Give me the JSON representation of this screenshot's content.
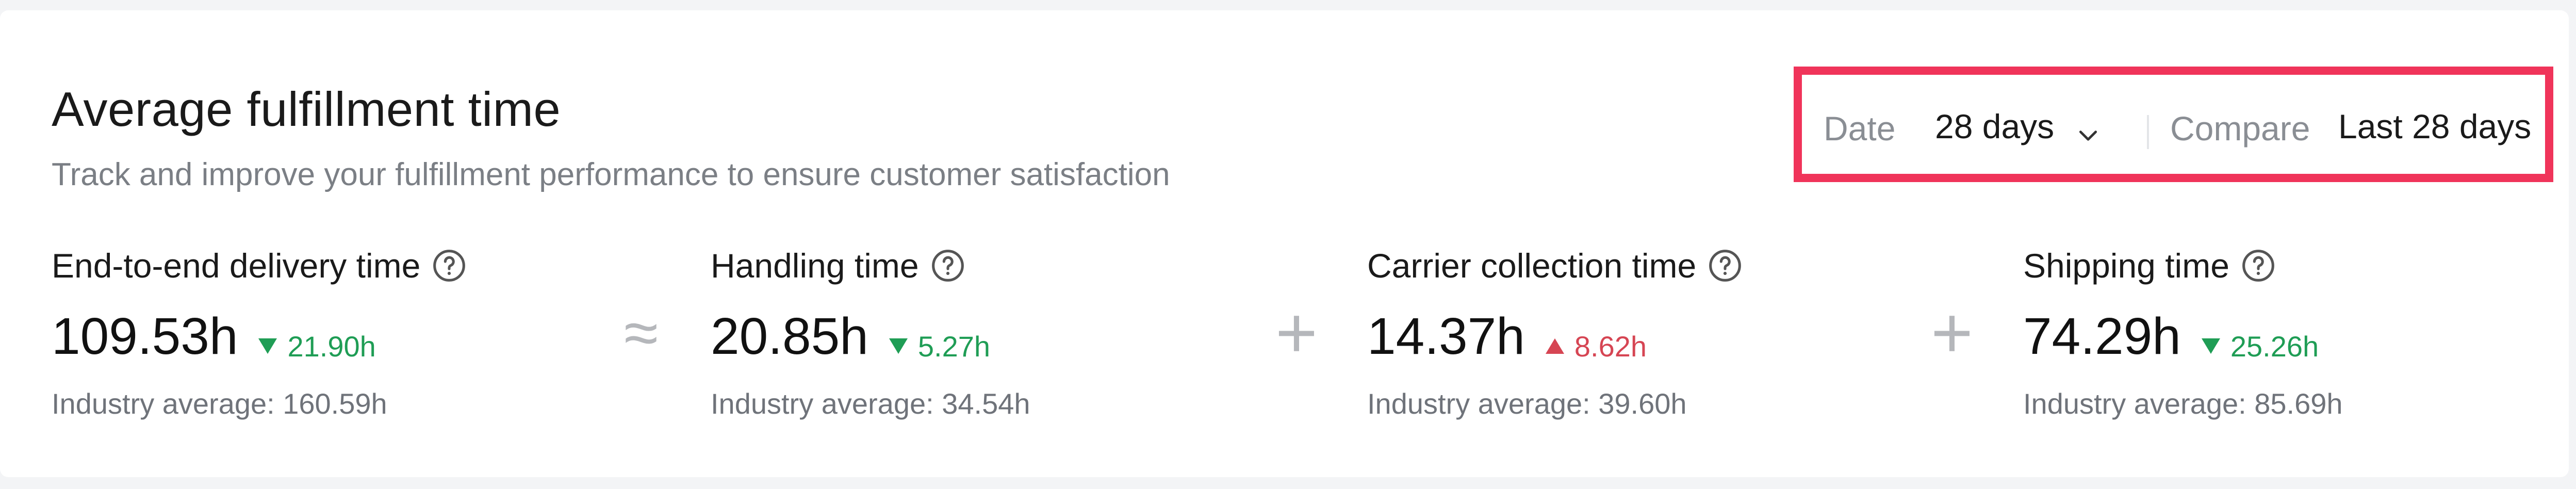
{
  "header": {
    "title": "Average fulfillment time",
    "subtitle": "Track and improve your fulfillment performance to ensure customer satisfaction"
  },
  "filters": {
    "date_label": "Date",
    "date_value": "28 days",
    "compare_label": "Compare",
    "compare_value": "Last 28 days",
    "highlight_color": "#f0345a"
  },
  "metrics": [
    {
      "title": "End-to-end delivery time",
      "value": "109.53h",
      "delta": "21.90h",
      "direction": "down",
      "industry": "Industry average: 160.59h"
    },
    {
      "title": "Handling time",
      "value": "20.85h",
      "delta": "5.27h",
      "direction": "down",
      "industry": "Industry average: 34.54h"
    },
    {
      "title": "Carrier collection time",
      "value": "14.37h",
      "delta": "8.62h",
      "direction": "up",
      "industry": "Industry average: 39.60h"
    },
    {
      "title": "Shipping time",
      "value": "74.29h",
      "delta": "25.26h",
      "direction": "down",
      "industry": "Industry average: 85.69h"
    }
  ],
  "operators": [
    "≈",
    "+",
    "+"
  ],
  "colors": {
    "positive": "#1f9d55",
    "negative": "#d64553"
  }
}
